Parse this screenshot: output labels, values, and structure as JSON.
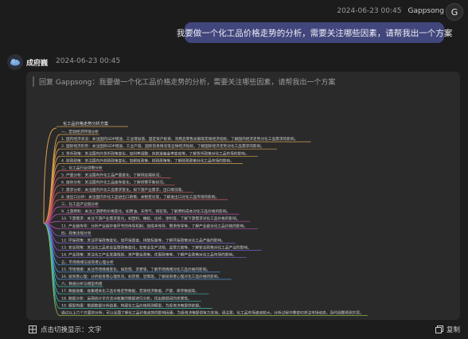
{
  "user": {
    "time": "2024-06-23 00:45",
    "name": "Gappsong",
    "avatar_letter": "G",
    "message": "我要做一个化工品价格走势的分析，需要关注哪些因素，请帮我出一个方案"
  },
  "bot": {
    "name": "成府巍",
    "time": "2024-06-23 00:45",
    "quote": "回复 Gappsong：我要做一个化工品价格走势的分析，需要关注哪些因素，请帮我出一个方案"
  },
  "mindmap": {
    "root": "化工品价格走势分析方案",
    "items": [
      {
        "text": "一、宏观经济环境分析",
        "color": "#d8a04a"
      },
      {
        "text": "1. 国内经济状况：关注国内GDP增速、工业增加值、固定资产投资、消费品零售总额等宏观经济指标，了解国内经济走势对化工品需求的影响。",
        "color": "#d8a04a"
      },
      {
        "text": "2. 国际经济形势：关注国际GDP增速、工业产值、国际贸易情况等全球经济指标，了解国际经济走势对化工品需求的影响。",
        "color": "#d8a04a"
      },
      {
        "text": "3. 货币政策：关注国内外货币政策变化，如利率调整、存款准备金率变动等，了解货币政策对化工品市场的影响。",
        "color": "#d8a04a"
      },
      {
        "text": "4. 财政政策：关注国内外财政政策变化，如税收政策、财政政策等，了解财政政策对化工品市场的影响。",
        "color": "#d8a04a"
      },
      {
        "text": "二、化工品行业供需分析",
        "color": "#c85a5a"
      },
      {
        "text": "5. 产量分析：关注国内外化工品产量变化，了解供应端状况。",
        "color": "#c85a5a"
      },
      {
        "text": "6. 库存分析：关注国内外化工品库存变化，了解供需平衡状况。",
        "color": "#c85a5a"
      },
      {
        "text": "7. 需求分析：关注国内外化工品需求变化，如下游产业需求、出口情况等。",
        "color": "#c85a5a"
      },
      {
        "text": "8. 进出口分析：关注国内外化工品进出口政策、关税变化等，了解进出口对化工品市场的影响。",
        "color": "#c85a5a"
      },
      {
        "text": "三、化工品产业链分析",
        "color": "#b44fa0"
      },
      {
        "text": "9. 上游原料：关注上游原料价格变化，如原油、天然气、煤炭等，了解原料成本对化工品价格的影响。",
        "color": "#b44fa0"
      },
      {
        "text": "10. 下游需求：关注下游产业需求变化，如塑料、橡胶、化纤、涂料等，了解下游需求对化工品价格的影响。",
        "color": "#b44fa0"
      },
      {
        "text": "11. 产业链传导：分析产业链中各环节的传导机制，如成本传导、需求传导等，了解产业链对化工品价格的影响。",
        "color": "#b44fa0"
      },
      {
        "text": "四、政策法规分析",
        "color": "#7a5cc8"
      },
      {
        "text": "12. 环保政策：关注环保政策变化，如环保督查、排放标准等，了解环保政策对化工品产能的影响。",
        "color": "#7a5cc8"
      },
      {
        "text": "13. 安全政策：关注化工品安全监管政策变化，如安全生产法规、监管力度等，了解安全政策对化工品产业的影响。",
        "color": "#7a5cc8"
      },
      {
        "text": "14. 产业政策：关注化工产业发展规划、资产整合政策、优惠政策等，了解产业政策对化工品市场的影响。",
        "color": "#7a5cc8"
      },
      {
        "text": "五、市场情绪与投资者心理分析",
        "color": "#4a8fd0"
      },
      {
        "text": "15. 市场情绪：关注市场情绪变化，如恐慌、贪婪等，了解市场情绪对化工品价格的影响。",
        "color": "#4a8fd0"
      },
      {
        "text": "16. 投资者心理：分析投资者心理状况，如贪婪、恐惧等，了解投资者心理对化工品价格的影响。",
        "color": "#4a8fd0"
      },
      {
        "text": "六、数据分析与模型构建",
        "color": "#3fb8b0"
      },
      {
        "text": "17. 数据收集：收集相关化工品价格走势数据、宏观经济数据、产量、库存数据等。",
        "color": "#3fb8b0"
      },
      {
        "text": "18. 数据分析：运用统计学方法对收集的数据进行分析，找出数据间的关联性。",
        "color": "#3fb8b0"
      },
      {
        "text": "19. 模型构建：根据数据分析结果，构建化工品价格预测模型，为投资决策提供依据。",
        "color": "#3fb8b0"
      },
      {
        "text": "通过以上六个方面的分析，可以全面了解化工品价格走势的影响因素，为投资决策提供有力支持。请注意，化工品市场波动较大，分析过程中需密切关注市场动态，及时调整预测方案。",
        "color": "#8ab84a"
      }
    ]
  },
  "footer": {
    "toggle_label": "点击切换显示：文字",
    "copy_label": "复制"
  }
}
